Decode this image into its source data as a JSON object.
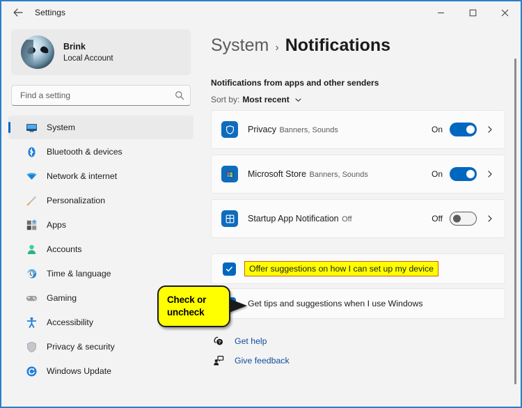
{
  "window": {
    "title": "Settings",
    "back_icon": "back-arrow-icon",
    "controls": {
      "minimize": "minimize-icon",
      "maximize": "maximize-icon",
      "close": "close-icon"
    }
  },
  "sidebar": {
    "account": {
      "name": "Brink",
      "subtitle": "Local Account",
      "avatar_alt": "alien-avatar"
    },
    "search": {
      "placeholder": "Find a setting",
      "value": "",
      "icon": "search-icon"
    },
    "items": [
      {
        "label": "System",
        "icon": "monitor-icon",
        "active": true
      },
      {
        "label": "Bluetooth & devices",
        "icon": "bluetooth-icon",
        "active": false
      },
      {
        "label": "Network & internet",
        "icon": "wifi-icon",
        "active": false
      },
      {
        "label": "Personalization",
        "icon": "paintbrush-icon",
        "active": false
      },
      {
        "label": "Apps",
        "icon": "apps-grid-icon",
        "active": false
      },
      {
        "label": "Accounts",
        "icon": "person-icon",
        "active": false
      },
      {
        "label": "Time & language",
        "icon": "clock-globe-icon",
        "active": false
      },
      {
        "label": "Gaming",
        "icon": "gamepad-icon",
        "active": false
      },
      {
        "label": "Accessibility",
        "icon": "accessibility-person-icon",
        "active": false
      },
      {
        "label": "Privacy & security",
        "icon": "shield-icon",
        "active": false
      },
      {
        "label": "Windows Update",
        "icon": "refresh-circle-icon",
        "active": false
      }
    ]
  },
  "content": {
    "breadcrumb": {
      "root": "System",
      "separator": "›",
      "current": "Notifications"
    },
    "section_header": "Notifications from apps and other senders",
    "sort": {
      "label": "Sort by:",
      "value": "Most recent",
      "chevron": "chevron-down-icon"
    },
    "apps": [
      {
        "name": "Privacy",
        "sub": "Banners, Sounds",
        "state": "On",
        "toggle_on": true,
        "icon": "privacy-shield-app-icon",
        "chevron": "chevron-right-icon"
      },
      {
        "name": "Microsoft Store",
        "sub": "Banners, Sounds",
        "state": "On",
        "toggle_on": true,
        "icon": "microsoft-store-app-icon",
        "chevron": "chevron-right-icon"
      },
      {
        "name": "Startup App Notification",
        "sub": "Off",
        "state": "Off",
        "toggle_on": false,
        "icon": "startup-app-icon",
        "chevron": "chevron-right-icon"
      }
    ],
    "checkboxes": [
      {
        "label": "Offer suggestions on how I can set up my device",
        "checked": true,
        "highlighted": true
      },
      {
        "label": "Get tips and suggestions when I use Windows",
        "checked": true,
        "highlighted": false
      }
    ],
    "links": [
      {
        "label": "Get help",
        "icon": "help-question-icon"
      },
      {
        "label": "Give feedback",
        "icon": "feedback-person-icon"
      }
    ]
  },
  "annotation": {
    "callout_line1": "Check or",
    "callout_line2": "uncheck"
  },
  "colors": {
    "accent": "#0067c0",
    "window_border": "#2a7fc9",
    "highlight_yellow": "#ffff00",
    "highlight_border": "#d06000",
    "link_blue": "#0f4c9e",
    "surface": "#f3f3f3",
    "card": "#fbfbfb"
  }
}
